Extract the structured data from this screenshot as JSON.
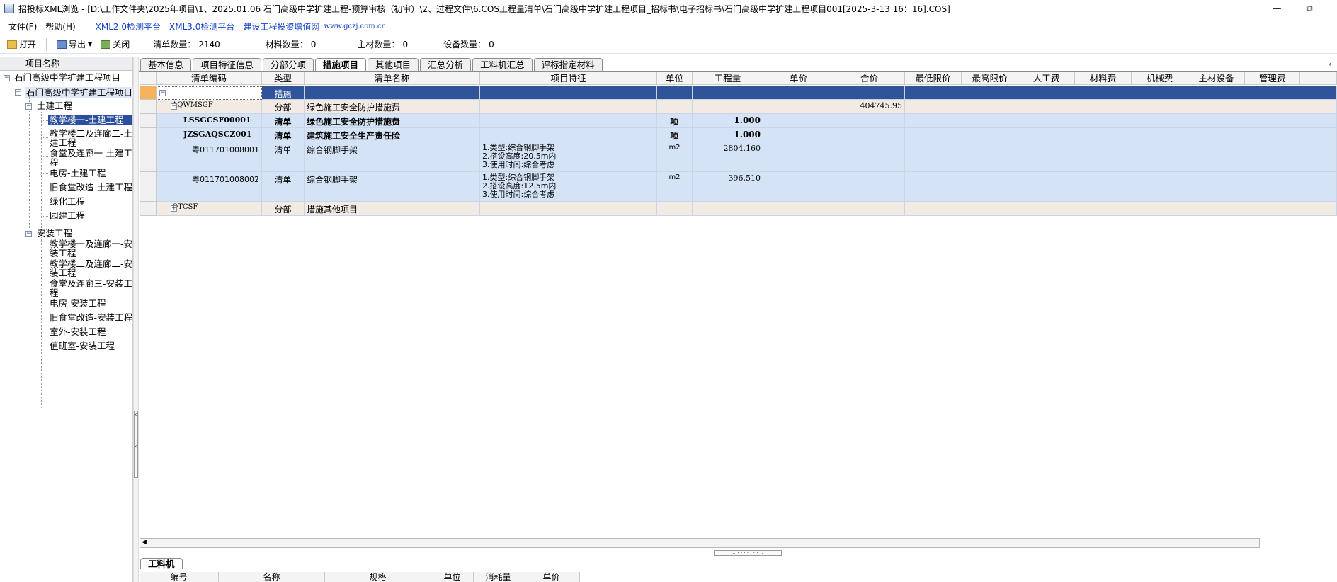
{
  "window": {
    "title": "招投标XML浏览 - [D:\\工作文件夹\\2025年项目\\1、2025.01.06 石门高级中学扩建工程-预算审核（初审）\\2、过程文件\\6.COS工程量清单\\石门高级中学扩建工程项目_招标书\\电子招标书\\石门高级中学扩建工程项目001[2025-3-13 16：16].COS]",
    "minimize_glyph": "—",
    "restore_glyph": "⧉"
  },
  "menu": {
    "file": "文件(F)",
    "help": "帮助(H)",
    "xml2": "XML2.0检测平台",
    "xml3": "XML3.0检测平台",
    "site": "建设工程投资增值网",
    "url": "www.gczj.com.cn"
  },
  "toolbar": {
    "open": "打开",
    "export": "导出",
    "close": "关闭",
    "bill_count_label": "清单数量：",
    "bill_count": "2140",
    "material_count_label": "材料数量：",
    "material_count": "0",
    "main_material_label": "主材数量：",
    "main_material_count": "0",
    "equipment_label": "设备数量：",
    "equipment_count": "0"
  },
  "tree": {
    "header": "项目名称",
    "root": "石门高级中学扩建工程项目",
    "project": "石门高级中学扩建工程项目",
    "civil": "土建工程",
    "civil_items": [
      "教学楼一-土建工程",
      "教学楼二及连廊二-土建工程",
      "食堂及连廊一-土建工程",
      "电房-土建工程",
      "旧食堂改造-土建工程",
      "绿化工程",
      "园建工程"
    ],
    "install": "安装工程",
    "install_items": [
      "教学楼一及连廊一-安装工程",
      "教学楼二及连廊二-安装工程",
      "食堂及连廊三-安装工程",
      "电房-安装工程",
      "旧食堂改造-安装工程",
      "室外-安装工程",
      "值班室-安装工程"
    ]
  },
  "tabs": [
    "基本信息",
    "项目特征信息",
    "分部分项",
    "措施项目",
    "其他项目",
    "汇总分析",
    "工料机汇总",
    "评标指定材料"
  ],
  "grid": {
    "headers": [
      "清单编码",
      "类型",
      "清单名称",
      "项目特征",
      "单位",
      "工程量",
      "单价",
      "合价",
      "最低限价",
      "最高限价",
      "人工费",
      "材料费",
      "机械费",
      "主材设备",
      "管理费"
    ],
    "rows": [
      {
        "code": "",
        "type": "措施",
        "name": "",
        "feature": "",
        "unit": "",
        "qty": "",
        "total": ""
      },
      {
        "code": "AQWMSGF",
        "type": "分部",
        "name": "绿色施工安全防护措施费",
        "feature": "",
        "unit": "",
        "qty": "",
        "total": "404745.95"
      },
      {
        "code": "LSSGCSF00001",
        "type": "清单",
        "name": "绿色施工安全防护措施费",
        "feature": "",
        "unit": "项",
        "qty": "1.000",
        "total": ""
      },
      {
        "code": "JZSGAQSCZ001",
        "type": "清单",
        "name": "建筑施工安全生产责任险",
        "feature": "",
        "unit": "项",
        "qty": "1.000",
        "total": ""
      },
      {
        "code": "粤011701008001",
        "type": "清单",
        "name": "综合钢脚手架",
        "feature": "1.类型:综合钢脚手架\n2.搭设高度:20.5m内\n3.使用时间:综合考虑",
        "unit": "m2",
        "qty": "2804.160",
        "total": ""
      },
      {
        "code": "粤011701008002",
        "type": "清单",
        "name": "综合钢脚手架",
        "feature": "1.类型:综合钢脚手架\n2.搭设高度:12.5m内\n3.使用时间:综合考虑",
        "unit": "m2",
        "qty": "396.510",
        "total": ""
      },
      {
        "code": "QTCSF",
        "type": "分部",
        "name": "措施其他项目",
        "feature": "",
        "unit": "",
        "qty": "",
        "total": ""
      }
    ]
  },
  "bottom": {
    "tab": "工料机",
    "headers": [
      "编号",
      "名称",
      "规格",
      "单位",
      "消耗量",
      "单价"
    ]
  },
  "colors": {
    "selected_row": "#2f5499",
    "part_row": "#f2ebe3",
    "bill_row": "#d4e3f5",
    "link": "#1240c8",
    "current_marker": "#f6b25d"
  }
}
